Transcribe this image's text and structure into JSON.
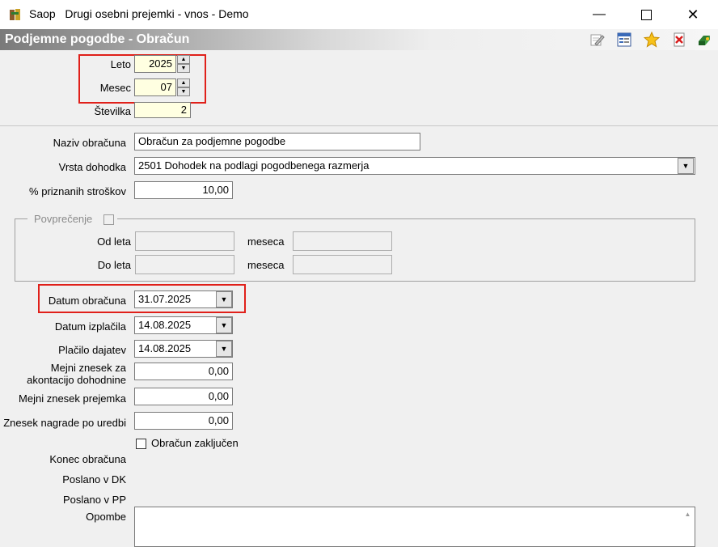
{
  "window": {
    "app_name": "Saop",
    "title": "Drugi osebni prejemki - vnos - Demo",
    "controls": [
      "minimize-icon",
      "maximize-icon",
      "close-icon"
    ]
  },
  "form": {
    "header": "Podjemne pogodbe - Obračun",
    "toolbar_icons": [
      "edit-icon",
      "list-icon",
      "star-icon",
      "delete-icon",
      "exit-icon"
    ]
  },
  "fields": {
    "leto": {
      "label": "Leto",
      "value": "2025"
    },
    "mesec": {
      "label": "Mesec",
      "value": "07"
    },
    "stevilka": {
      "label": "Številka",
      "value": "2"
    },
    "naziv": {
      "label": "Naziv obračuna",
      "value": "Obračun za podjemne pogodbe"
    },
    "vrsta": {
      "label": "Vrsta dohodka",
      "value": "2501  Dohodek na podlagi pogodbenega razmerja"
    },
    "stroski": {
      "label": "% priznanih stroškov",
      "value": "10,00"
    },
    "povprecenje": {
      "label": "Povprečenje",
      "checked": false,
      "od_leta": "Od leta",
      "do_leta": "Do leta",
      "meseca1": "meseca",
      "meseca2": "meseca"
    },
    "datum_obracuna": {
      "label": "Datum obračuna",
      "value": "31.07.2025"
    },
    "datum_izplacila": {
      "label": "Datum izplačila",
      "value": "14.08.2025"
    },
    "placilo_dajatev": {
      "label": "Plačilo dajatev",
      "value": "14.08.2025"
    },
    "mejni_akont_l1": "Mejni znesek za",
    "mejni_akont_l2": "akontacijo dohodnine",
    "mejni_akont_value": "0,00",
    "mejni_prejemka": {
      "label": "Mejni znesek prejemka",
      "value": "0,00"
    },
    "nagrade": {
      "label": "Znesek nagrade po uredbi",
      "value": "0,00"
    },
    "zakljucen": {
      "label": "Obračun zaključen",
      "checked": false
    },
    "konec": {
      "label": "Konec obračuna"
    },
    "poslano_dk": {
      "label": "Poslano v DK"
    },
    "poslano_pp": {
      "label": "Poslano v PP"
    },
    "opombe": {
      "label": "Opombe",
      "value": ""
    }
  },
  "colors": {
    "highlight": "#e0201a",
    "key_field": "#ffffe1"
  }
}
